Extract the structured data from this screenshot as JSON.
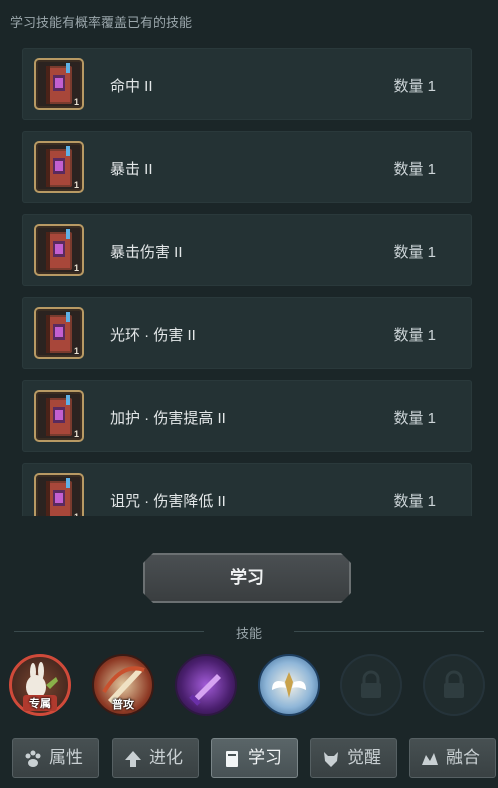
{
  "hint": "学习技能有概率覆盖已有的技能",
  "items": [
    {
      "name": "命中 II",
      "qty": "数量 1",
      "count": "1"
    },
    {
      "name": "暴击 II",
      "qty": "数量 1",
      "count": "1"
    },
    {
      "name": "暴击伤害 II",
      "qty": "数量 1",
      "count": "1"
    },
    {
      "name": "光环 · 伤害 II",
      "qty": "数量 1",
      "count": "1"
    },
    {
      "name": "加护 · 伤害提高 II",
      "qty": "数量 1",
      "count": "1"
    },
    {
      "name": "诅咒 · 伤害降低 II",
      "qty": "数量 1",
      "count": "1"
    }
  ],
  "learn_button": "学习",
  "skills_section": "技能",
  "skill_slots": [
    {
      "icon": "rabbit-exclusive-skill-icon",
      "tag": "专属",
      "color": "#c0392b"
    },
    {
      "icon": "normal-attack-icon",
      "tag": "普攻",
      "color": "#b5452a"
    },
    {
      "icon": "purple-sword-skill-icon",
      "tag": "",
      "color": "#6a2fa8"
    },
    {
      "icon": "winged-emblem-skill-icon",
      "tag": "",
      "color": "#3f7fb8"
    },
    {
      "icon": "lock-icon",
      "tag": ""
    },
    {
      "icon": "lock-icon",
      "tag": ""
    }
  ],
  "tabs": [
    {
      "label": "属性",
      "icon": "paw-icon",
      "active": false
    },
    {
      "label": "进化",
      "icon": "up-arrow-icon",
      "active": false
    },
    {
      "label": "学习",
      "icon": "book-icon",
      "active": true
    },
    {
      "label": "觉醒",
      "icon": "wolf-icon",
      "active": false
    },
    {
      "label": "融合",
      "icon": "fusion-icon",
      "active": false
    }
  ]
}
